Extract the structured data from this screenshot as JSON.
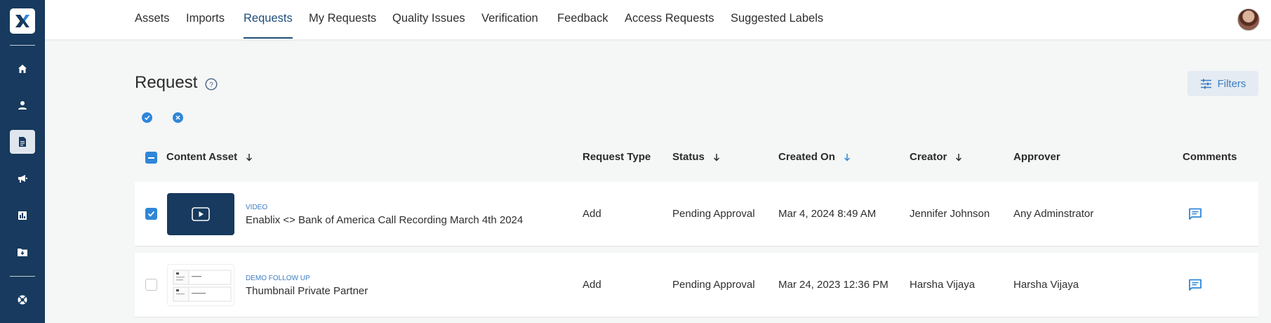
{
  "nav": {
    "tabs": [
      {
        "label": "Assets"
      },
      {
        "label": "Imports"
      },
      {
        "label": "Requests",
        "active": true
      },
      {
        "label": "My Requests"
      },
      {
        "label": "Quality Issues"
      },
      {
        "label": "Verification"
      },
      {
        "label": "Feedback"
      },
      {
        "label": "Access Requests"
      },
      {
        "label": "Suggested Labels"
      }
    ]
  },
  "sidebar": {
    "items": [
      {
        "icon": "home-icon"
      },
      {
        "icon": "user-icon"
      },
      {
        "icon": "document-icon",
        "active": true
      },
      {
        "icon": "megaphone-icon"
      },
      {
        "icon": "bar-chart-icon"
      },
      {
        "icon": "folder-download-icon"
      },
      {
        "icon": "support-icon"
      }
    ]
  },
  "page": {
    "title": "Request",
    "filters_label": "Filters"
  },
  "table": {
    "columns": {
      "content_asset": "Content Asset",
      "request_type": "Request Type",
      "status": "Status",
      "created_on": "Created On",
      "creator": "Creator",
      "approver": "Approver",
      "comments": "Comments"
    },
    "rows": [
      {
        "checked": true,
        "asset_type": "Video",
        "asset_name": "Enablix <> Bank of America Call Recording March 4th 2024",
        "request_type": "Add",
        "status": "Pending Approval",
        "created_on": "Mar 4, 2024 8:49 AM",
        "creator": "Jennifer Johnson",
        "approver": "Any Adminstrator"
      },
      {
        "checked": false,
        "asset_type": "Demo Follow Up",
        "asset_name": "Thumbnail Private Partner",
        "request_type": "Add",
        "status": "Pending Approval",
        "created_on": "Mar 24, 2023 12:36 PM",
        "creator": "Harsha Vijaya",
        "approver": "Harsha Vijaya"
      }
    ]
  },
  "colors": {
    "sidebar": "#173a5e",
    "accent": "#2f86d8",
    "link": "#3c7dc4",
    "active_tab": "#1f4d7a"
  }
}
